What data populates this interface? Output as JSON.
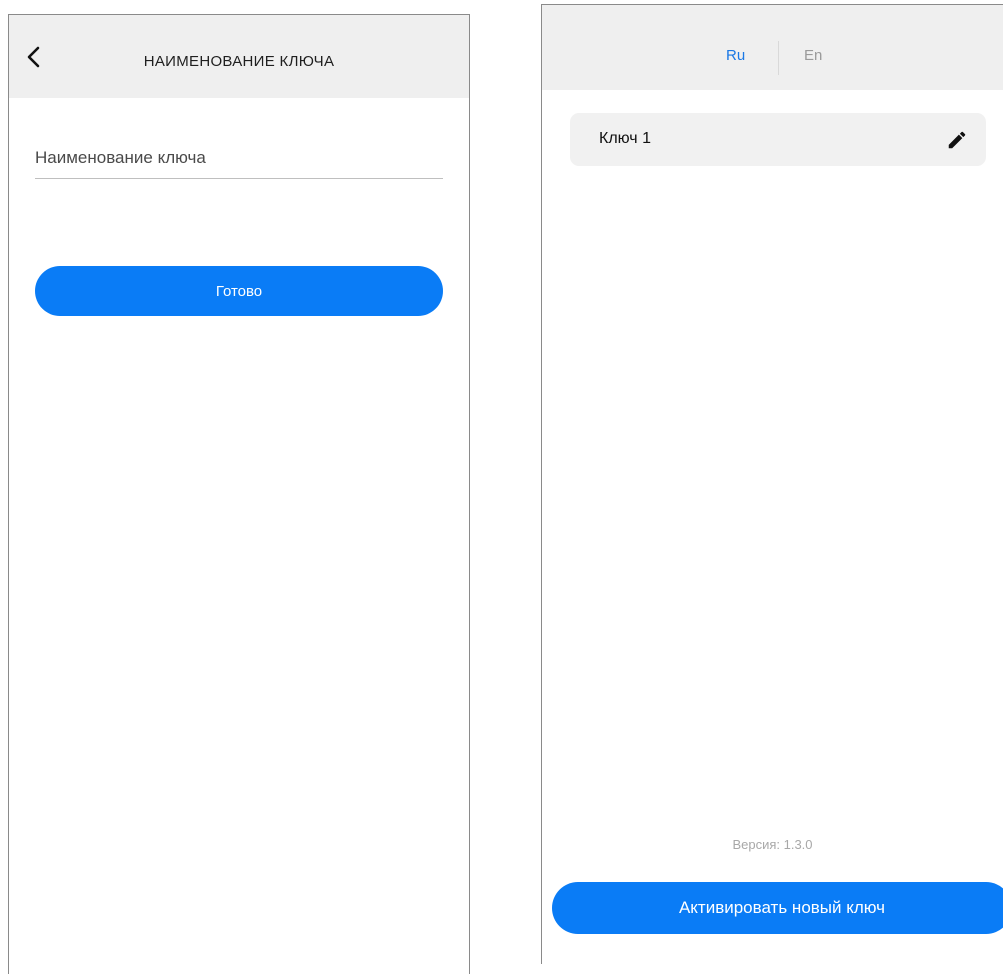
{
  "left_screen": {
    "header": {
      "title": "НАИМЕНОВАНИЕ КЛЮЧА",
      "back_icon": "chevron-left-icon"
    },
    "key_name_input": {
      "placeholder": "Наименование ключа",
      "value": ""
    },
    "done_button": {
      "label": "Готово"
    }
  },
  "right_screen": {
    "language": {
      "options": [
        "Ru",
        "En"
      ],
      "selected": "Ru"
    },
    "keys": [
      {
        "label": "Ключ 1",
        "edit_icon": "pencil-icon"
      }
    ],
    "version": "Версия: 1.3.0",
    "activate_button": {
      "label": "Активировать новый ключ"
    }
  },
  "colors": {
    "accent": "#0a7cf6",
    "header_bg": "#efefef",
    "key_item_bg": "#f1f1f1",
    "lang_active": "#1a78e5",
    "lang_inactive": "#9a9a9a"
  }
}
